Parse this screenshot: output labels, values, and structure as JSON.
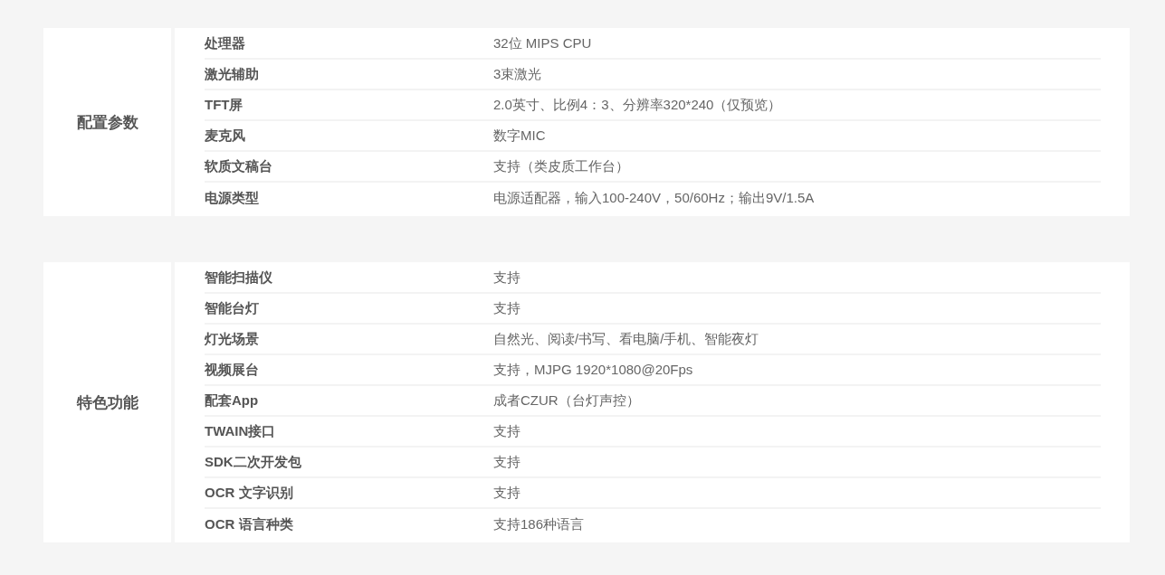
{
  "sections": [
    {
      "title": "配置参数",
      "rows": [
        {
          "label": "处理器",
          "value": "32位 MIPS CPU"
        },
        {
          "label": "激光辅助",
          "value": "3束激光"
        },
        {
          "label": "TFT屏",
          "value": "2.0英寸、比例4：3、分辨率320*240（仅预览）"
        },
        {
          "label": "麦克风",
          "value": "数字MIC"
        },
        {
          "label": "软质文稿台",
          "value": "支持（类皮质工作台）"
        },
        {
          "label": "电源类型",
          "value": "电源适配器，输入100-240V，50/60Hz；输出9V/1.5A"
        }
      ]
    },
    {
      "title": "特色功能",
      "rows": [
        {
          "label": "智能扫描仪",
          "value": "支持"
        },
        {
          "label": "智能台灯",
          "value": "支持"
        },
        {
          "label": "灯光场景",
          "value": "自然光、阅读/书写、看电脑/手机、智能夜灯"
        },
        {
          "label": "视频展台",
          "value": "支持，MJPG 1920*1080@20Fps"
        },
        {
          "label": "配套App",
          "value": "成者CZUR（台灯声控）"
        },
        {
          "label": "TWAIN接口",
          "value": "支持"
        },
        {
          "label": "SDK二次开发包",
          "value": "支持"
        },
        {
          "label": "OCR 文字识别",
          "value": "支持"
        },
        {
          "label": "OCR 语言种类",
          "value": "支持186种语言"
        }
      ]
    }
  ]
}
